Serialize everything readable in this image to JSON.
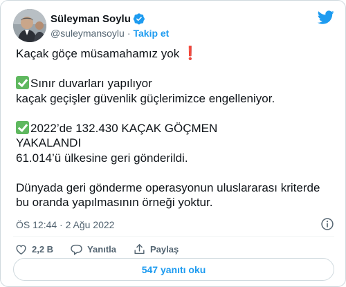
{
  "author": {
    "display_name": "Süleyman Soylu",
    "handle": "@suleymansoylu",
    "separator": "·",
    "follow_label": "Takip et",
    "verified": true,
    "verified_color": "#1d9bf0"
  },
  "tweet": {
    "line1": "Kaçak göçe müsamahamız yok",
    "line2": "Sınır duvarları yapılıyor",
    "line3": "kaçak geçişler güvenlik güçlerimizce engelleniyor.",
    "line4": "2022’de 132.430 KAÇAK GÖÇMEN",
    "line5": "YAKALANDI",
    "line6": "61.014’ü ülkesine geri gönderildi.",
    "line7": "Dünyada geri gönderme operasyonun uluslararası kriterde",
    "line8": "bu oranda yapılmasının örneği yoktur.",
    "icons": [
      "exclamation-mark-icon",
      "check-mark-button-icon"
    ]
  },
  "meta": {
    "timestamp": "ÖS 12:44 · 2 Ağu 2022"
  },
  "actions": {
    "like_count": "2,2 B",
    "reply_label": "Yanıtla",
    "share_label": "Paylaş"
  },
  "replies_button": {
    "label": "547 yanıtı oku"
  },
  "colors": {
    "accent": "#1d9bf0",
    "text": "#0f1419",
    "muted": "#536471",
    "check": "#5fb85f",
    "exclamation": "#e0245e"
  }
}
